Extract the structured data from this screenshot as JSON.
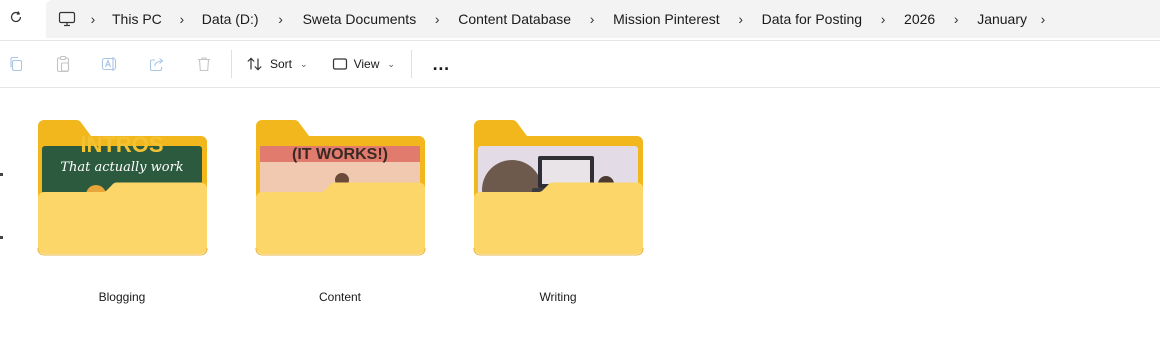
{
  "address_bar": {
    "breadcrumbs": [
      "This PC",
      "Data (D:)",
      "Sweta Documents",
      "Content Database",
      "Mission Pinterest",
      "Data for Posting",
      "2026",
      "January"
    ]
  },
  "toolbar": {
    "sort_label": "Sort",
    "view_label": "View",
    "more_label": "…"
  },
  "folders": [
    {
      "name": "Blogging",
      "preview_text": [
        "INTROS",
        "That actually work"
      ]
    },
    {
      "name": "Content",
      "preview_text": [
        "(IT WORKS!)"
      ]
    },
    {
      "name": "Writing",
      "preview_text": []
    }
  ],
  "colors": {
    "folder_back": "#f2b71c",
    "folder_front": "#fdd66a",
    "accent": "#0067c0"
  }
}
